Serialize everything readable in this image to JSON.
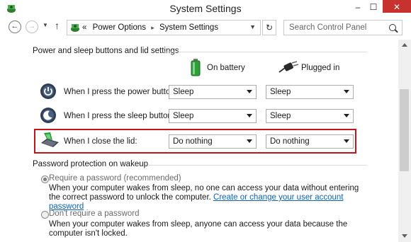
{
  "window": {
    "title": "System Settings",
    "minimize": "–",
    "maximize": "☐",
    "close": "✕"
  },
  "nav": {
    "back": "←",
    "forward": "→",
    "recent": "▼",
    "up": "↑"
  },
  "address": {
    "lead": "«",
    "crumbs": [
      "Power Options",
      "System Settings"
    ],
    "separator": "▸",
    "dropdown": "▼",
    "refresh": "↻"
  },
  "search": {
    "placeholder": "Search Control Panel"
  },
  "section_buttons": {
    "title": "Power and sleep buttons and lid settings",
    "col_battery": "On battery",
    "col_plugged": "Plugged in",
    "rows": [
      {
        "label": "When I press the power button:",
        "battery": "Sleep",
        "plugged": "Sleep",
        "icon": "power-button-icon"
      },
      {
        "label": "When I press the sleep button:",
        "battery": "Sleep",
        "plugged": "Sleep",
        "icon": "sleep-button-icon"
      },
      {
        "label": "When I close the lid:",
        "battery": "Do nothing",
        "plugged": "Do nothing",
        "icon": "laptop-lid-icon"
      }
    ]
  },
  "section_password": {
    "title": "Password protection on wakeup",
    "option1_label": "Require a password (recommended)",
    "option1_desc": "When your computer wakes from sleep, no one can access your data without entering the correct password to unlock the computer.",
    "option1_link": "Create or change your user account password",
    "option2_label": "Don't require a password",
    "option2_desc": "When your computer wakes from sleep, anyone can access your data because the computer isn't locked.",
    "selected": 1
  },
  "colors": {
    "highlight": "#c0151b",
    "close_button": "#c7312e",
    "link": "#0b63b6"
  }
}
